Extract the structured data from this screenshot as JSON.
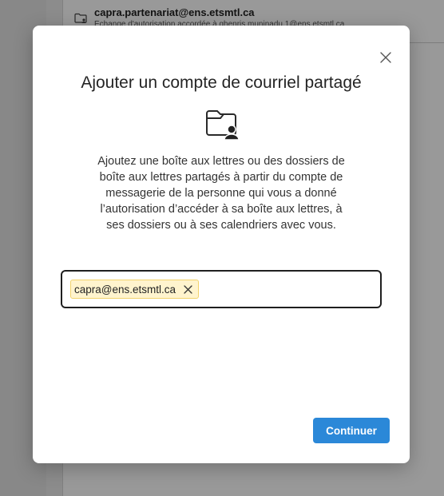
{
  "background": {
    "list_item": {
      "title": "capra.partenariat@ens.etsmtl.ca",
      "subtitle": "Échange d'autorisation accordée à ghenris.muninadu.1@ens.etsmtl.ca",
      "icon": "shared-folder-icon"
    }
  },
  "dialog": {
    "title": "Ajouter un compte de courriel partagé",
    "hero_icon": "shared-folder-person-icon",
    "description": "Ajoutez une boîte aux lettres ou des dossiers de boîte aux lettres partagés à partir du compte de messagerie de la personne qui vous a donné l’autorisation d’accéder à sa boîte aux lettres, à ses dossiers ou à ses calendriers avec vous.",
    "recipients": [
      {
        "label": "capra@ens.etsmtl.ca"
      }
    ],
    "input_value": "",
    "continue_label": "Continuer",
    "close_icon": "close-icon"
  },
  "colors": {
    "primary": "#2b88d8",
    "chip_bg": "#fff4ce",
    "chip_border": "#f2d36b"
  }
}
